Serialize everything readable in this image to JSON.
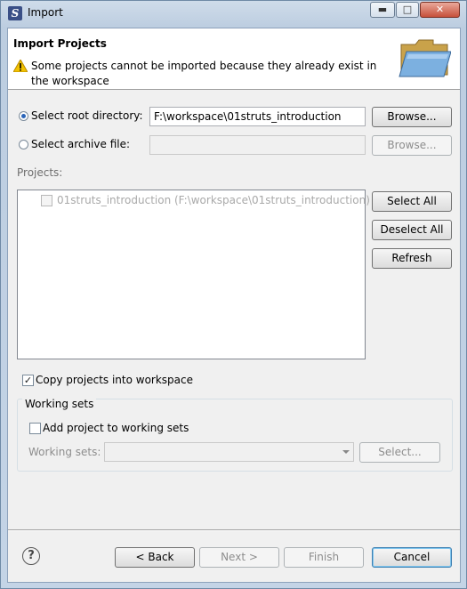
{
  "window": {
    "title": "Import",
    "app_icon": "eclipse-icon",
    "minimize": "minimize-icon",
    "maximize": "maximize-icon",
    "close": "close-icon"
  },
  "header": {
    "title": "Import Projects",
    "message": "Some projects cannot be imported because they already exist in the workspace",
    "message_icon": "warning-icon",
    "image": "folder-icon"
  },
  "source": {
    "root_dir_label": "Select root directory:",
    "root_dir_value": "F:\\workspace\\01struts_introduction",
    "root_selected": true,
    "archive_label": "Select archive file:",
    "archive_value": "",
    "browse_label": "Browse...",
    "browse_archive_label": "Browse..."
  },
  "projects": {
    "label": "Projects:",
    "items": [
      {
        "label": "01struts_introduction (F:\\workspace\\01struts_introduction)",
        "checked": false,
        "enabled": false
      }
    ],
    "select_all": "Select All",
    "deselect_all": "Deselect All",
    "refresh": "Refresh"
  },
  "options": {
    "copy_label": "Copy projects into workspace",
    "copy_checked": true
  },
  "working_sets": {
    "group_title": "Working sets",
    "add_label": "Add project to working sets",
    "add_checked": false,
    "sets_label": "Working sets:",
    "sets_value": "",
    "select_label": "Select..."
  },
  "footer": {
    "help_icon": "help-icon",
    "back": "< Back",
    "next": "Next >",
    "finish": "Finish",
    "cancel": "Cancel"
  },
  "colors": {
    "title_gradient": "#c4d4e6",
    "dialog_bg": "#f0f0f0",
    "disabled_text": "#8d8d8d",
    "default_button_border": "#3c7fb1"
  }
}
